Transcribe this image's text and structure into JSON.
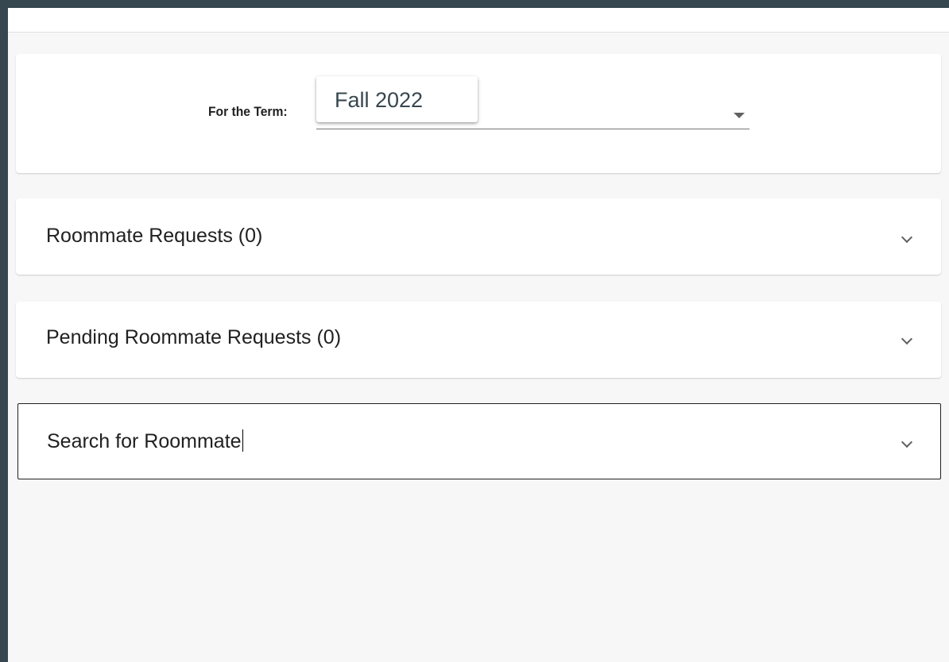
{
  "term": {
    "label": "For the Term:",
    "selected": "Fall 2022"
  },
  "panels": [
    {
      "title": "Roommate Requests (0)"
    },
    {
      "title": "Pending Roommate Requests (0)"
    },
    {
      "title": "Search for Roommate"
    }
  ],
  "icons": {
    "dropdown": "caret-down-icon",
    "expand": "chevron-down-icon"
  },
  "colors": {
    "outer_background": "#37474f",
    "page_background": "#f7f7f7",
    "card_background": "#ffffff",
    "text": "#212121"
  }
}
